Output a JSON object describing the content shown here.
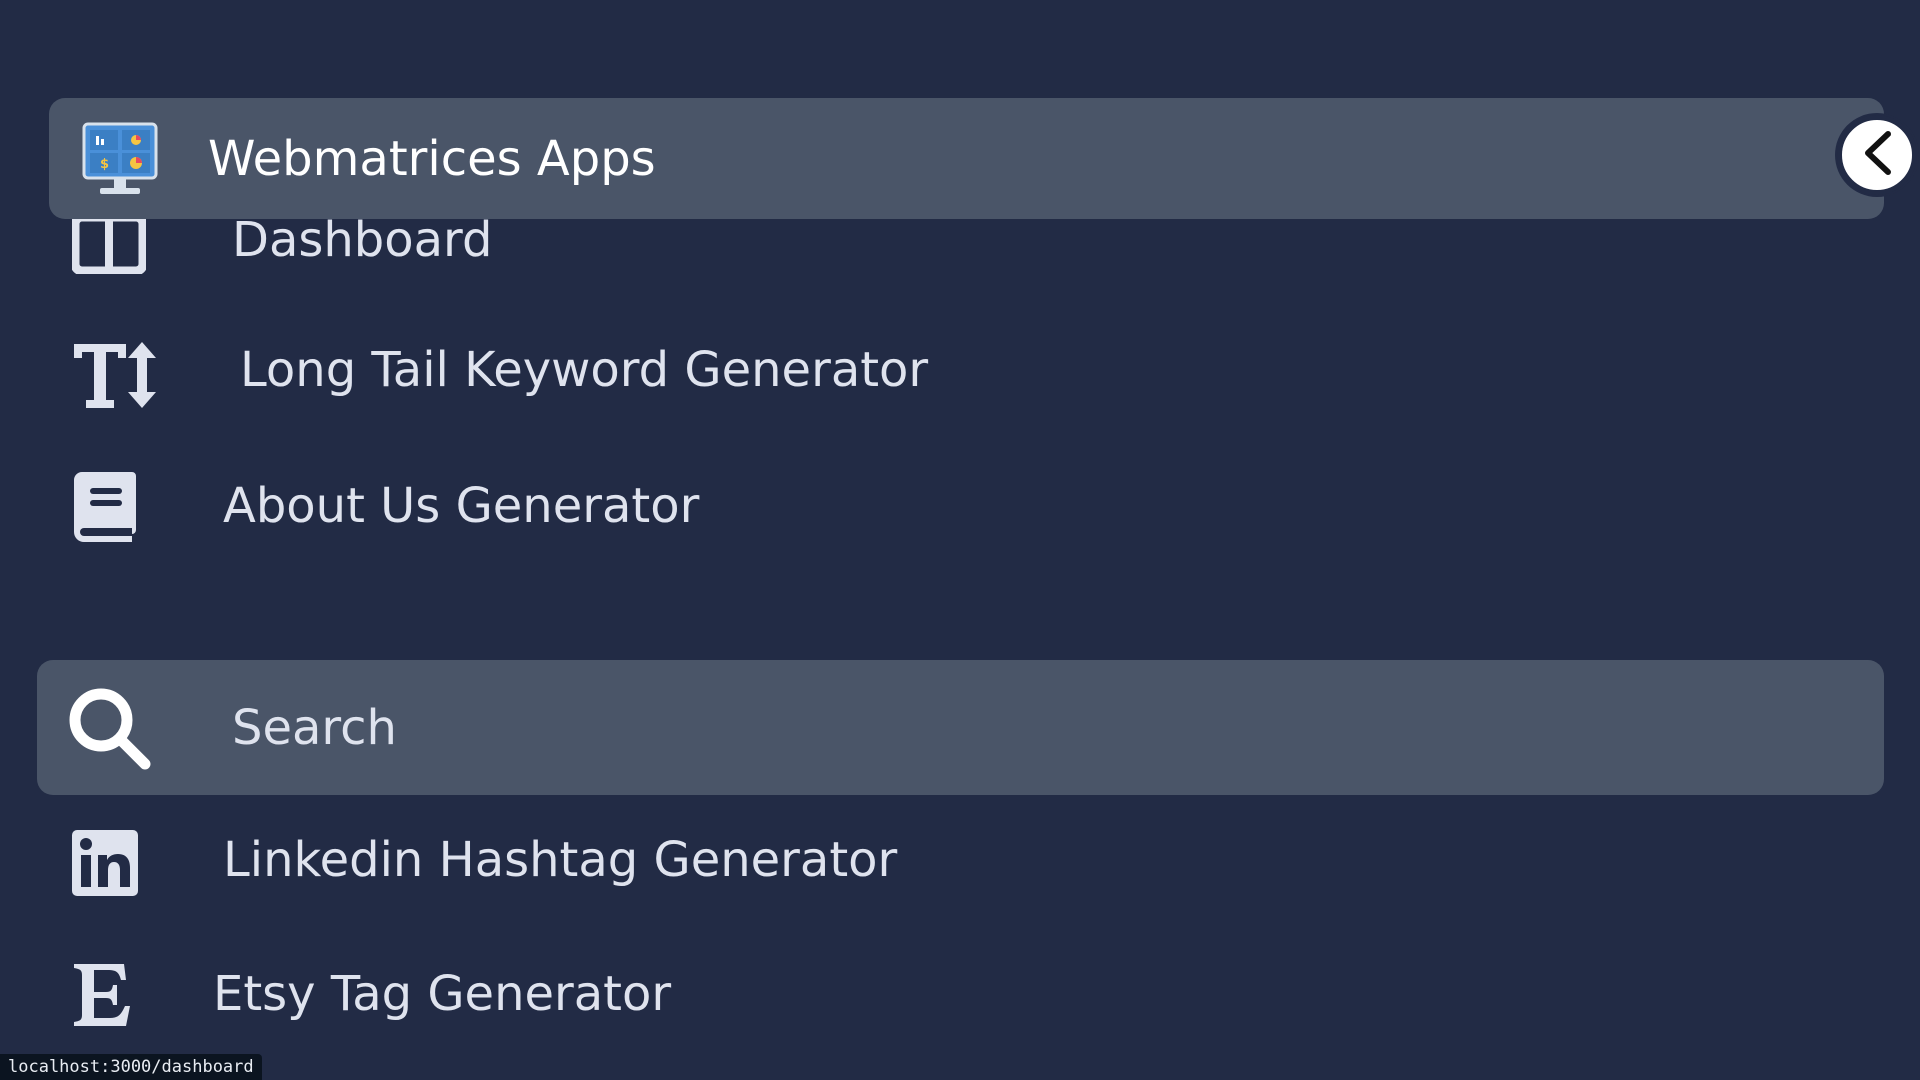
{
  "app": {
    "title": "Webmatrices Apps",
    "logo_icon": "monitor-dashboard-icon",
    "collapse_icon": "chevron-left-icon"
  },
  "nav_top": [
    {
      "label": "Dashboard",
      "icon": "columns-icon"
    },
    {
      "label": "Long Tail Keyword Generator",
      "icon": "text-height-icon"
    },
    {
      "label": "About Us Generator",
      "icon": "book-icon"
    }
  ],
  "search": {
    "placeholder": "Search",
    "value": "",
    "icon": "search-icon"
  },
  "nav_bottom": [
    {
      "label": "Linkedin Hashtag Generator",
      "icon": "linkedin-icon"
    },
    {
      "label": "Etsy Tag Generator",
      "icon": "etsy-icon"
    }
  ],
  "status_bar": {
    "url": "localhost:3000/dashboard"
  },
  "colors": {
    "background": "#222b45",
    "panel": "#4a5568",
    "text": "#dfe3ee",
    "title": "#ffffff"
  }
}
